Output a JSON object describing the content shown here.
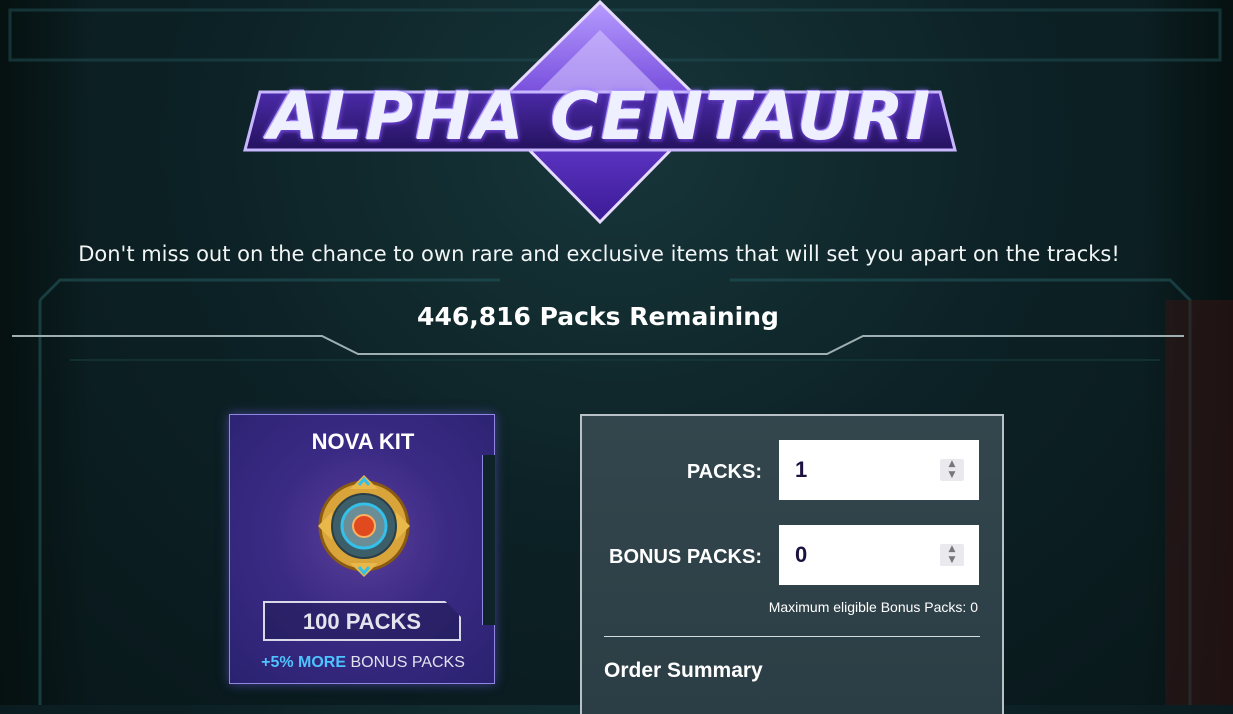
{
  "logo": {
    "text": "ALPHA CENTAURI"
  },
  "tagline": "Don't miss out on the chance to own rare and exclusive items that will set you apart on the tracks!",
  "remaining": {
    "count": "446,816",
    "label": "Packs Remaining"
  },
  "pack_card": {
    "title": "NOVA KIT",
    "count_label": "100 PACKS",
    "bonus_highlight": "+5% MORE",
    "bonus_text": "BONUS PACKS",
    "emblem_icon": "nova-kit-emblem-icon"
  },
  "order": {
    "packs_label": "PACKS:",
    "packs_value": "1",
    "bonus_label": "BONUS PACKS:",
    "bonus_value": "0",
    "max_note": "Maximum eligible Bonus Packs: 0",
    "summary_title": "Order Summary"
  },
  "colors": {
    "background": "#0d2226",
    "card_purple": "#3a2a84",
    "accent_blue": "#4ec3ff",
    "panel": "#33464d"
  }
}
